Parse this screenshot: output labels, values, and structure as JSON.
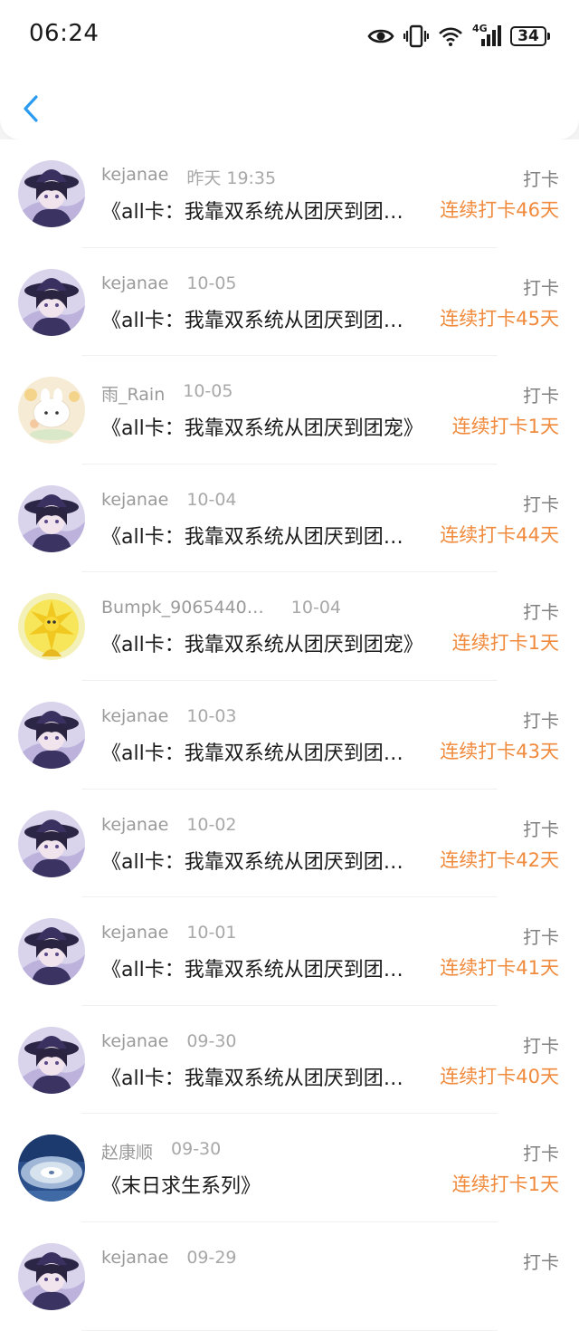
{
  "status_bar": {
    "time": "06:24",
    "icons": [
      "eye-icon",
      "vibrate-icon",
      "wifi-icon",
      "signal-4g-icon",
      "battery-icon"
    ],
    "network_label": "4G",
    "battery_level": "34"
  },
  "nav": {
    "back_icon": "chevron-left-icon",
    "accent_color": "#2a9bf0"
  },
  "colors": {
    "streak": "#f08a3c",
    "meta": "#9a9a9a",
    "title": "#1a1a1a"
  },
  "list": {
    "items": [
      {
        "username": "kejanae",
        "time": "昨天 19:35",
        "tag": "打卡",
        "title": "《all卡：我靠双系统从团厌到团…",
        "streak": "连续打卡46天",
        "avatar": "avatar-purple-hat"
      },
      {
        "username": "kejanae",
        "time": "10-05",
        "tag": "打卡",
        "title": "《all卡：我靠双系统从团厌到团…",
        "streak": "连续打卡45天",
        "avatar": "avatar-purple-hat"
      },
      {
        "username": "雨_Rain",
        "time": "10-05",
        "tag": "打卡",
        "title": "《all卡：我靠双系统从团厌到团宠》",
        "streak": "连续打卡1天",
        "avatar": "avatar-bunny"
      },
      {
        "username": "kejanae",
        "time": "10-04",
        "tag": "打卡",
        "title": "《all卡：我靠双系统从团厌到团…",
        "streak": "连续打卡44天",
        "avatar": "avatar-purple-hat"
      },
      {
        "username": "Bumpk_9065440…",
        "time": "10-04",
        "tag": "打卡",
        "title": "《all卡：我靠双系统从团厌到团宠》",
        "streak": "连续打卡1天",
        "avatar": "avatar-yellow"
      },
      {
        "username": "kejanae",
        "time": "10-03",
        "tag": "打卡",
        "title": "《all卡：我靠双系统从团厌到团…",
        "streak": "连续打卡43天",
        "avatar": "avatar-purple-hat"
      },
      {
        "username": "kejanae",
        "time": "10-02",
        "tag": "打卡",
        "title": "《all卡：我靠双系统从团厌到团…",
        "streak": "连续打卡42天",
        "avatar": "avatar-purple-hat"
      },
      {
        "username": "kejanae",
        "time": "10-01",
        "tag": "打卡",
        "title": "《all卡：我靠双系统从团厌到团…",
        "streak": "连续打卡41天",
        "avatar": "avatar-purple-hat"
      },
      {
        "username": "kejanae",
        "time": "09-30",
        "tag": "打卡",
        "title": "《all卡：我靠双系统从团厌到团…",
        "streak": "连续打卡40天",
        "avatar": "avatar-purple-hat"
      },
      {
        "username": "赵康顺",
        "time": "09-30",
        "tag": "打卡",
        "title": "《末日求生系列》",
        "streak": "连续打卡1天",
        "avatar": "avatar-storm"
      },
      {
        "username": "kejanae",
        "time": "09-29",
        "tag": "打卡",
        "title": "",
        "streak": "",
        "avatar": "avatar-purple-hat"
      }
    ]
  }
}
